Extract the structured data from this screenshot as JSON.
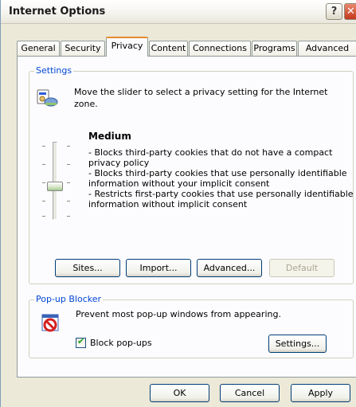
{
  "window": {
    "title": "Internet Options",
    "help_button": "?",
    "close_button": "✕"
  },
  "tabs": [
    "General",
    "Security",
    "Privacy",
    "Content",
    "Connections",
    "Programs",
    "Advanced"
  ],
  "active_tab": "Privacy",
  "settings": {
    "group_label": "Settings",
    "intro_line1": "Move the slider to select a privacy setting for the Internet",
    "intro_line2": "zone.",
    "level": "Medium",
    "slider_level": "Medium",
    "description": [
      "- Blocks third-party cookies that do not have a compact",
      "privacy policy",
      "- Blocks third-party cookies that use personally identifiable",
      "information without your implicit consent",
      "- Restricts first-party cookies that use personally identifiable",
      "information without implicit consent"
    ],
    "buttons": {
      "sites": "Sites...",
      "import": "Import...",
      "advanced": "Advanced...",
      "default": "Default"
    }
  },
  "popup_blocker": {
    "group_label": "Pop-up Blocker",
    "description": "Prevent most pop-up windows from appearing.",
    "checkbox_label": "Block pop-ups",
    "checkbox_checked": true,
    "settings_button": "Settings..."
  },
  "footer": {
    "ok": "OK",
    "cancel": "Cancel",
    "apply": "Apply"
  },
  "colors": {
    "group_label": "#0046d5",
    "active_tab_accent": "#e68b2c",
    "dialog_bg": "#ece9d8"
  }
}
